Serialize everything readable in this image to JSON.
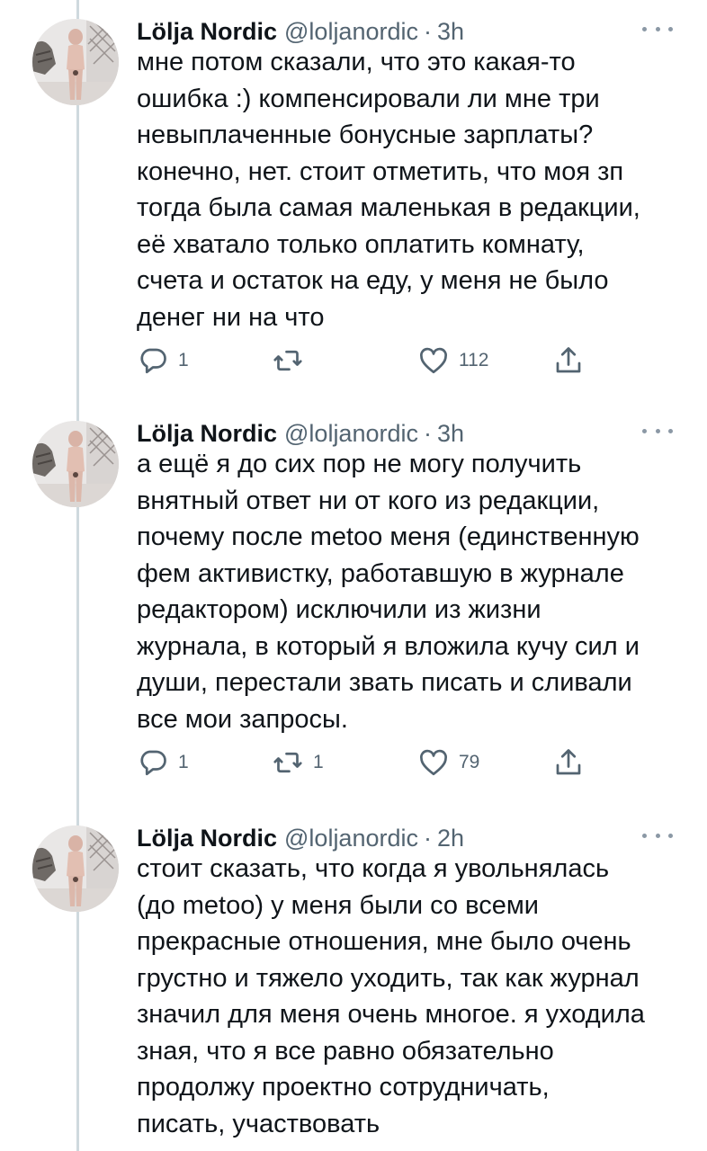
{
  "tweets": [
    {
      "author": "Lölja Nordic",
      "handle": "@loljanordic",
      "separator": "·",
      "time": "3h",
      "text": "мне потом сказали, что это какая-то\nошибка :) компенсировали ли мне три\nневыплаченные бонусные зарплаты?\nконечно, нет. стоит отметить, что моя зп\nтогда была самая маленькая в редакции,\nеё хватало только оплатить комнату,\nсчета и остаток на еду, у меня не было\nденег ни на что",
      "replies": "1",
      "retweets": "",
      "likes": "112"
    },
    {
      "author": "Lölja Nordic",
      "handle": "@loljanordic",
      "separator": "·",
      "time": "3h",
      "text": "а ещё я до сих пор не могу получить\nвнятный ответ ни от кого из редакции,\nпочему после metoo меня (единственную\nфем активистку, работавшую в журнале\nредактором)  исключили из жизни\nжурнала, в который я вложила кучу сил и\nдуши, перестали звать писать и сливали\nвсе мои запросы.",
      "replies": "1",
      "retweets": "1",
      "likes": "79"
    },
    {
      "author": "Lölja Nordic",
      "handle": "@loljanordic",
      "separator": "·",
      "time": "2h",
      "text": "стоит сказать, что когда я увольнялась\n(до metoo) у меня были со всеми\nпрекрасные отношения, мне было очень\nгрустно и тяжело уходить, так как журнал\nзначил для меня очень многое. я уходила\nзная, что я все равно обязательно\nпродолжу проектно сотрудничать,\nписать, участвовать",
      "replies": "",
      "retweets": "",
      "likes": ""
    }
  ],
  "icons": {
    "reply": "reply-icon",
    "retweet": "retweet-icon",
    "like": "heart-icon",
    "share": "share-icon",
    "more": "more-options-icon",
    "avatar": "avatar"
  },
  "colors": {
    "text": "#0f1419",
    "secondary": "#536471",
    "thread_line": "#cfd9de"
  }
}
